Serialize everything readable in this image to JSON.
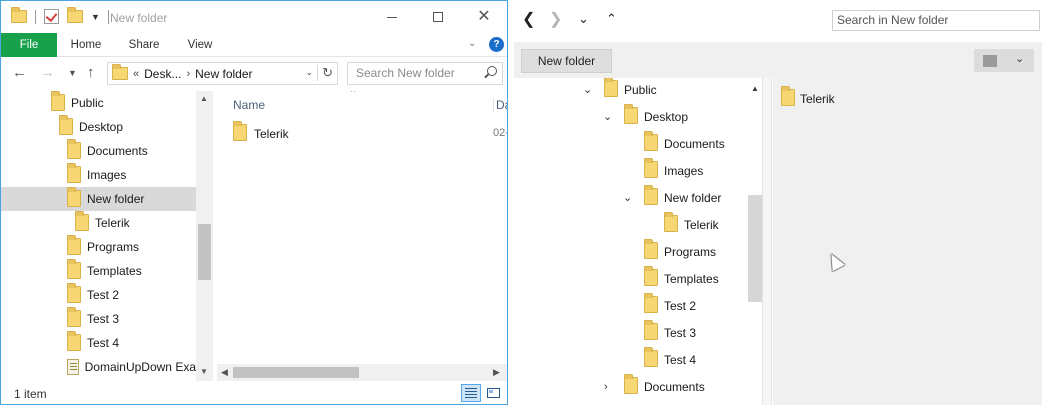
{
  "explorer": {
    "title": "New folder",
    "ribbon_tabs": {
      "file": "File",
      "home": "Home",
      "share": "Share",
      "view": "View"
    },
    "address": {
      "chevrons": "«",
      "crumb_1": "Desk...",
      "crumb_2": "New folder"
    },
    "search_placeholder": "Search New folder",
    "nav_items": [
      {
        "label": "Public",
        "icon": "folder-icon"
      },
      {
        "label": "Desktop",
        "icon": "folder-icon"
      },
      {
        "label": "Documents",
        "icon": "folder-icon"
      },
      {
        "label": "Images",
        "icon": "folder-icon"
      },
      {
        "label": "New folder",
        "icon": "folder-icon",
        "selected": true
      },
      {
        "label": "Telerik",
        "icon": "folder-icon"
      },
      {
        "label": "Programs",
        "icon": "folder-icon"
      },
      {
        "label": "Templates",
        "icon": "folder-icon"
      },
      {
        "label": "Test 2",
        "icon": "folder-icon"
      },
      {
        "label": "Test 3",
        "icon": "folder-icon"
      },
      {
        "label": "Test 4",
        "icon": "folder-icon"
      },
      {
        "label": "DomainUpDown Exa",
        "icon": "file-icon"
      }
    ],
    "columns": {
      "name": "Name",
      "date": "Da"
    },
    "files": [
      {
        "name": "Telerik",
        "date": "02-"
      }
    ],
    "status": "1 item"
  },
  "dialog": {
    "search_placeholder": "Search in New folder",
    "new_folder_label": "New folder",
    "tree": [
      {
        "label": "Public",
        "expander": "expanded"
      },
      {
        "label": "Desktop",
        "expander": "expanded"
      },
      {
        "label": "Documents",
        "expander": "none"
      },
      {
        "label": "Images",
        "expander": "none"
      },
      {
        "label": "New folder",
        "expander": "expanded"
      },
      {
        "label": "Telerik",
        "expander": "none"
      },
      {
        "label": "Programs",
        "expander": "none"
      },
      {
        "label": "Templates",
        "expander": "none"
      },
      {
        "label": "Test 2",
        "expander": "none"
      },
      {
        "label": "Test 3",
        "expander": "none"
      },
      {
        "label": "Test 4",
        "expander": "none"
      },
      {
        "label": "Documents",
        "expander": "collapsed"
      }
    ],
    "items": [
      {
        "name": "Telerik"
      }
    ]
  },
  "colors": {
    "accent_green": "#19a04b",
    "window_border": "#4aa3df",
    "selection": "#d9d9d9",
    "help_blue": "#1b6ec9"
  }
}
